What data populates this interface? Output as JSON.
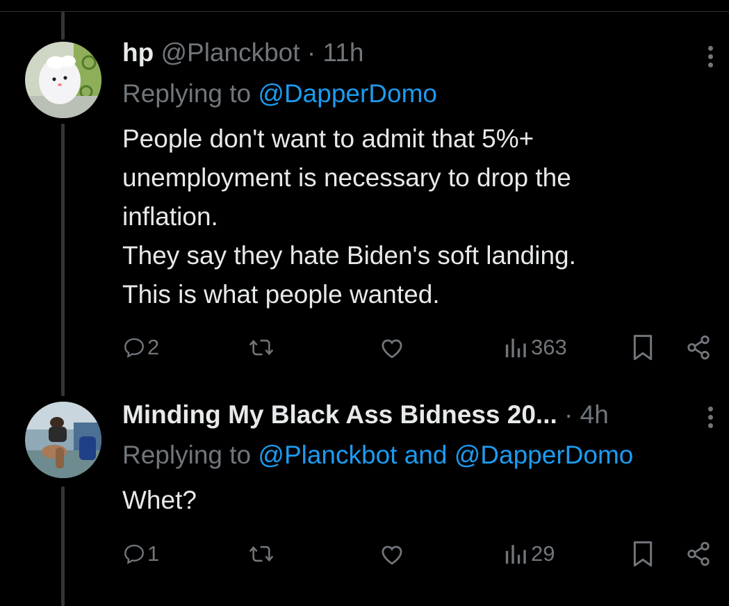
{
  "colors": {
    "background": "#000000",
    "text": "#e7e9ea",
    "muted": "#71767b",
    "mention": "#1d9bf0",
    "thread_line": "#333639"
  },
  "tweets": [
    {
      "display_name": "hp",
      "handle": "@Planckbot",
      "separator": "·",
      "time": "11h",
      "replying_prefix": "Replying to",
      "reply_mentions": [
        "@DapperDomo"
      ],
      "text_lines": [
        "People don't want to admit that 5%+",
        "unemployment is necessary to drop the",
        "inflation.",
        "They say they hate Biden's soft landing.",
        "This is what people wanted."
      ],
      "replies": "2",
      "views": "363",
      "avatar": "ghost-avatar"
    },
    {
      "display_name": "Minding My Black Ass Bidness 20...",
      "separator": "·",
      "time": "4h",
      "replying_prefix": "Replying to",
      "reply_mentions": [
        "@Planckbot",
        "@DapperDomo"
      ],
      "reply_joiner": "and",
      "text_lines": [
        "Whet?"
      ],
      "replies": "1",
      "views": "29",
      "avatar": "person-photo-avatar"
    }
  ],
  "icons": [
    "reply-icon",
    "retweet-icon",
    "like-icon",
    "views-icon",
    "bookmark-icon",
    "share-icon",
    "more-icon"
  ]
}
